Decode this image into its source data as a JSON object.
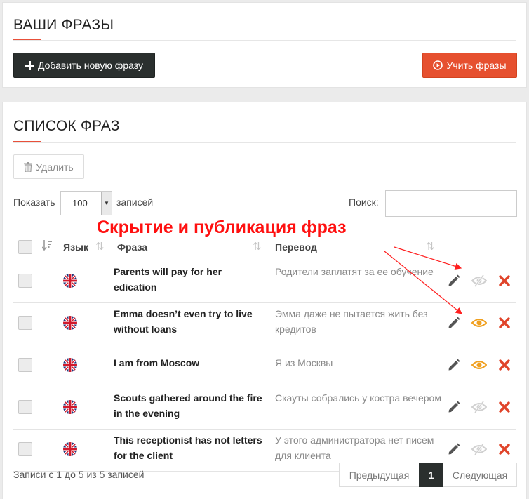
{
  "top_panel": {
    "title": "ВАШИ ФРАЗЫ",
    "add_button": "Добавить новую фразу",
    "learn_button": "Учить фразы"
  },
  "list_panel": {
    "title": "СПИСОК ФРАЗ",
    "delete_button": "Удалить",
    "show_label": "Показать",
    "page_size": "100",
    "records_label": "записей",
    "search_label": "Поиск:",
    "search_value": "",
    "annotation": "Скрытие и публикация фраз",
    "columns": {
      "lang": "Язык",
      "phrase": "Фраза",
      "translation": "Перевод"
    },
    "rows": [
      {
        "phrase": "Parents will pay for her edication",
        "translation": "Родители заплатят за ее обучение",
        "language": "English (UK flag)",
        "visibility": "hidden"
      },
      {
        "phrase": "Emma doesn’t even try to live without loans",
        "translation": "Эмма даже не пытается жить без кредитов",
        "language": "English (UK flag)",
        "visibility": "visible"
      },
      {
        "phrase": "I am from Moscow",
        "translation": "Я из Москвы",
        "language": "English (UK flag)",
        "visibility": "visible"
      },
      {
        "phrase": "Scouts gathered around the fire in the evening",
        "translation": "Скауты собрались у костра вечером",
        "language": "English (UK flag)",
        "visibility": "hidden"
      },
      {
        "phrase": "This receptionist has not letters for the client",
        "translation": "У этого администратора нет писем для клиента",
        "language": "English (UK flag)",
        "visibility": "hidden"
      }
    ],
    "info_text": "Записи с 1 до 5 из 5 записей",
    "pagination": {
      "prev": "Предыдущая",
      "current": "1",
      "next": "Следующая"
    }
  },
  "colors": {
    "accent_red": "#e6502f",
    "dark_button": "#2a2f2e",
    "visible_eye": "#f0a020",
    "hidden_eye": "#d0d0d0",
    "delete_x": "#e0442a",
    "annotation": "#ff1010"
  },
  "icons": {
    "add": "plus-icon",
    "learn": "play-circle-icon",
    "delete": "trash-icon",
    "sort": "sort-arrows-icon",
    "edit": "pencil-icon",
    "visible": "eye-icon",
    "hidden": "eye-slash-icon",
    "remove": "close-icon",
    "lang": "uk-flag-icon"
  }
}
